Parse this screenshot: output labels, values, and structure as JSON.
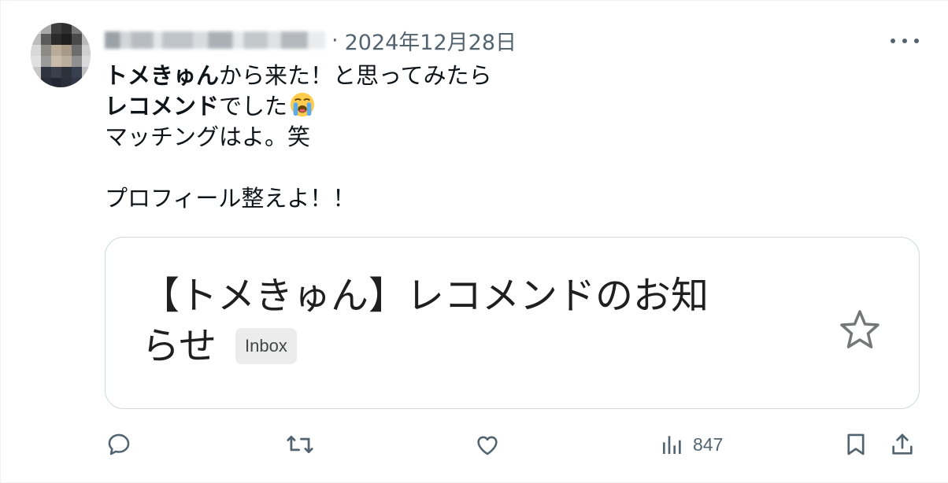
{
  "tweet": {
    "date": "2024年12月28日",
    "separator": "·",
    "body": {
      "line1_bold": "トメきゅん",
      "line1_rest": "から来た！と思ってみたら",
      "line2_bold": "レコメンド",
      "line2_rest": "でした",
      "line2_emoji": "loudly-crying-face-icon",
      "line3": "マッチングはよ。笑",
      "line5": "プロフィール整えよ！！"
    },
    "card": {
      "title_line1": "【トメきゅん】レコメンドのお知",
      "title_line2": "らせ",
      "chip_label": "Inbox",
      "star_icon": "star-outline-icon"
    },
    "actions": {
      "reply_icon": "reply-icon",
      "retweet_icon": "retweet-icon",
      "like_icon": "heart-icon",
      "views_icon": "views-chart-icon",
      "views_count": "847",
      "bookmark_icon": "bookmark-icon",
      "share_icon": "share-icon"
    }
  },
  "colors": {
    "secondary_text": "#536471",
    "primary_text": "#0f1419",
    "card_border": "#cfd9de"
  }
}
